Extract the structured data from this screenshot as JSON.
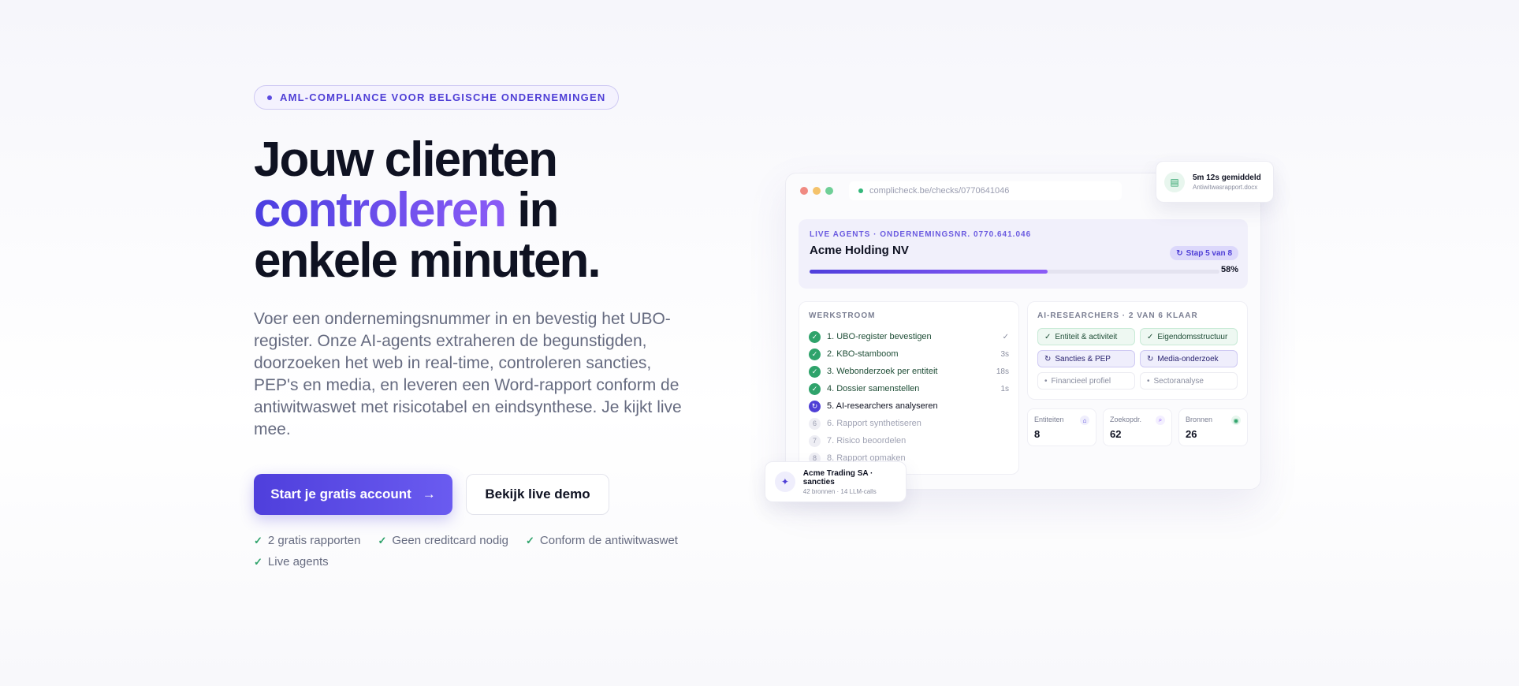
{
  "hero": {
    "eyebrow": "AML-COMPLIANCE VOOR BELGISCHE ONDERNEMINGEN",
    "headline_line1": "Jouw clienten",
    "headline_accent": "controleren",
    "headline_after_accent": " in",
    "headline_line3": "enkele minuten.",
    "lead": "Voer een ondernemingsnummer in en bevestig het UBO-register. Onze AI-agents extraheren de begunstigden, doorzoeken het web in real-time, controleren sancties, PEP's en media, en leveren een Word-rapport conform de antiwitwaswet met risicotabel en eindsynthese. Je kijkt live mee.",
    "cta_primary": "Start je gratis account",
    "cta_primary_arrow": "→",
    "cta_secondary": "Bekijk live demo",
    "checks": [
      "2 gratis rapporten",
      "Geen creditcard nodig",
      "Conform de antiwitwaswet",
      "Live agents"
    ]
  },
  "mockup": {
    "url": "complicheck.be/checks/0770641046",
    "status": {
      "label": "LIVE AGENTS · ONDERNEMINGSNR. 0770.641.046",
      "company": "Acme Holding NV",
      "step": "Stap 5 van 8",
      "progress": 58,
      "progress_label": "58%"
    },
    "workflow": {
      "label": "WERKSTROOM",
      "steps": [
        {
          "label": "1. UBO-register bevestigen",
          "state": "done",
          "time": "✓",
          "marker": "✓"
        },
        {
          "label": "2. KBO-stamboom",
          "state": "done",
          "time": "3s",
          "marker": "✓"
        },
        {
          "label": "3. Webonderzoek per entiteit",
          "state": "done",
          "time": "18s",
          "marker": "✓"
        },
        {
          "label": "4. Dossier samenstellen",
          "state": "done",
          "time": "1s",
          "marker": "✓"
        },
        {
          "label": "5. AI-researchers analyseren",
          "state": "active",
          "time": "",
          "marker": "↻"
        },
        {
          "label": "6. Rapport synthetiseren",
          "state": "pending",
          "time": "",
          "marker": "6"
        },
        {
          "label": "7. Risico beoordelen",
          "state": "pending",
          "time": "",
          "marker": "7"
        },
        {
          "label": "8. Rapport opmaken",
          "state": "pending",
          "time": "",
          "marker": "8"
        }
      ]
    },
    "researchers": {
      "label": "AI-RESEARCHERS · 2 VAN 6 KLAAR",
      "items": [
        {
          "label": "Entiteit & activiteit",
          "state": "done",
          "mark": "✓"
        },
        {
          "label": "Eigendomsstructuur",
          "state": "done",
          "mark": "✓"
        },
        {
          "label": "Sancties & PEP",
          "state": "running",
          "mark": "↻"
        },
        {
          "label": "Media-onderzoek",
          "state": "running",
          "mark": "↻"
        },
        {
          "label": "Financieel profiel",
          "state": "queued",
          "mark": "•"
        },
        {
          "label": "Sectoranalyse",
          "state": "queued",
          "mark": "•"
        }
      ]
    },
    "stats": [
      {
        "label": "Entiteiten",
        "value": "8",
        "icon": "⌂",
        "color": "#4f3fd6",
        "bg": "#efeefc"
      },
      {
        "label": "Zoekopdr.",
        "value": "62",
        "icon": "⌕",
        "color": "#8b5cf6",
        "bg": "#f3efff"
      },
      {
        "label": "Bronnen",
        "value": "26",
        "icon": "◉",
        "color": "#2fa36b",
        "bg": "#e8f6ee"
      }
    ]
  },
  "float_doc": {
    "title": "5m 12s gemiddeld",
    "sub": "Antiwitwasrapport.docx"
  },
  "float_agent": {
    "title": "Acme Trading SA · sancties",
    "sub": "42 bronnen · 14 LLM-calls"
  }
}
